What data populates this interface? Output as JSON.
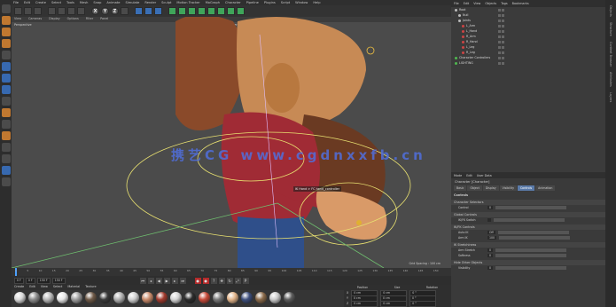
{
  "menubar": [
    "File",
    "Edit",
    "Create",
    "Select",
    "Tools",
    "Mesh",
    "Snap",
    "Animate",
    "Simulate",
    "Render",
    "Sculpt",
    "Motion Tracker",
    "MoGraph",
    "Character",
    "Pipeline",
    "Plugins",
    "Script",
    "Window",
    "Help"
  ],
  "toolbar": {
    "icons": [
      "undo-icon",
      "redo-icon",
      "live-select-icon",
      "move-icon",
      "scale-icon",
      "rotate-icon",
      "recent-icon",
      "x-axis-icon",
      "y-axis-icon",
      "z-axis-icon",
      "world-coords-icon",
      "render-view-icon",
      "render-picture-icon",
      "edit-render-settings-icon",
      "cube-icon",
      "pen-icon",
      "subdivision-icon",
      "array-icon",
      "deformer-icon",
      "floor-icon",
      "camera-icon",
      "light-icon"
    ],
    "axis_labels": [
      "X",
      "Y",
      "Z"
    ]
  },
  "viewport": {
    "menu": [
      "View",
      "Cameras",
      "Display",
      "Options",
      "Filter",
      "Panel"
    ],
    "label": "Perspective",
    "camera": "Default Camera",
    "ik_label": "IK Hand > FC hand_controller",
    "info": "Grid Spacing : 100 cm",
    "watermark": "携艺CG  www.cgdnxxfb.cn"
  },
  "timeline": {
    "ticks": [
      "0",
      "5",
      "10",
      "15",
      "20",
      "25",
      "30",
      "35",
      "40",
      "45",
      "50",
      "55",
      "60",
      "65",
      "70",
      "75",
      "80",
      "85",
      "90",
      "95",
      "100",
      "105",
      "110",
      "115",
      "120",
      "125",
      "130",
      "135",
      "140",
      "145",
      "150"
    ],
    "current_frame": "0 F"
  },
  "transport": {
    "start": "0 F",
    "fields": [
      "0 F",
      "150 F",
      "150 F"
    ]
  },
  "materials": {
    "menu": [
      "Create",
      "Edit",
      "View",
      "Select",
      "Material",
      "Texture"
    ],
    "swatches": [
      "#d9d9d9",
      "#8a8a8a",
      "#b7b7b7",
      "#e6e6e6",
      "#9c9c9c",
      "#6f5a48",
      "#3a3a3a",
      "#b0b0b0",
      "#cfcfcf",
      "#c98a6a",
      "#a23b2e",
      "#d4d4d4",
      "#2b2b2b",
      "#c74a3a",
      "#777777",
      "#e2b48a",
      "#3d4e7c",
      "#8a6a4a",
      "#c9c9c9",
      "#5c5c5c"
    ]
  },
  "coords": {
    "headers": [
      "Position",
      "Size",
      "Rotation"
    ],
    "rows": [
      {
        "axis": "X",
        "pos": "0 cm",
        "size": "0 cm",
        "rot": "0 °"
      },
      {
        "axis": "Y",
        "pos": "0 cm",
        "size": "0 cm",
        "rot": "0 °"
      },
      {
        "axis": "Z",
        "pos": "0 cm",
        "size": "0 cm",
        "rot": "0 °"
      }
    ]
  },
  "objmgr": {
    "menu": [
      "File",
      "Edit",
      "View",
      "Objects",
      "Tags",
      "Bookmarks"
    ],
    "rows": [
      {
        "name": "Root",
        "color": "#bbbbbb",
        "indent": 1
      },
      {
        "name": "Null",
        "color": "#bbbbbb",
        "indent": 2
      },
      {
        "name": "Joints",
        "color": "#bbbbbb",
        "indent": 2
      },
      {
        "name": "L_Arm",
        "color": "#cc4444",
        "indent": 3
      },
      {
        "name": "L_Hand",
        "color": "#cc4444",
        "indent": 3
      },
      {
        "name": "R_Arm",
        "color": "#cc4444",
        "indent": 3
      },
      {
        "name": "R_Hand",
        "color": "#cc4444",
        "indent": 3
      },
      {
        "name": "L_Leg",
        "color": "#cc4444",
        "indent": 3
      },
      {
        "name": "R_Leg",
        "color": "#cc4444",
        "indent": 3
      },
      {
        "name": "Character Controllers",
        "color": "#4fb84f",
        "indent": 1
      },
      {
        "name": "LIGHTING",
        "color": "#4fb84f",
        "indent": 1
      }
    ]
  },
  "attr": {
    "menu": [
      "Mode",
      "Edit",
      "User Data"
    ],
    "title": "Character [Character]",
    "tabs": [
      "Basic",
      "Object",
      "Display",
      "Visibility",
      "Controls",
      "Animation"
    ],
    "active_tab": 4,
    "heading": "Controls",
    "sections": [
      {
        "title": "Character Selectors",
        "rows": [
          {
            "label": "Control",
            "value": "0"
          }
        ]
      },
      {
        "title": "Global Controls",
        "rows": [
          {
            "label": "IK/FK Switch",
            "value": ""
          }
        ]
      },
      {
        "title": "IK/FK Controls",
        "rows": [
          {
            "label": "Auto IK",
            "value": "Off"
          },
          {
            "label": "Arm IK",
            "value": "100"
          }
        ]
      },
      {
        "title": "IK Stretchiness",
        "rows": [
          {
            "label": "Arm Stretch",
            "value": "0"
          },
          {
            "label": "Softness",
            "value": "0"
          }
        ]
      },
      {
        "title": "Hide Other Objects",
        "rows": [
          {
            "label": "Visibility",
            "value": "0"
          }
        ]
      }
    ]
  },
  "rightscroll": [
    "Objects",
    "Structure",
    "Content Browser",
    "Attributes",
    "Layers"
  ]
}
